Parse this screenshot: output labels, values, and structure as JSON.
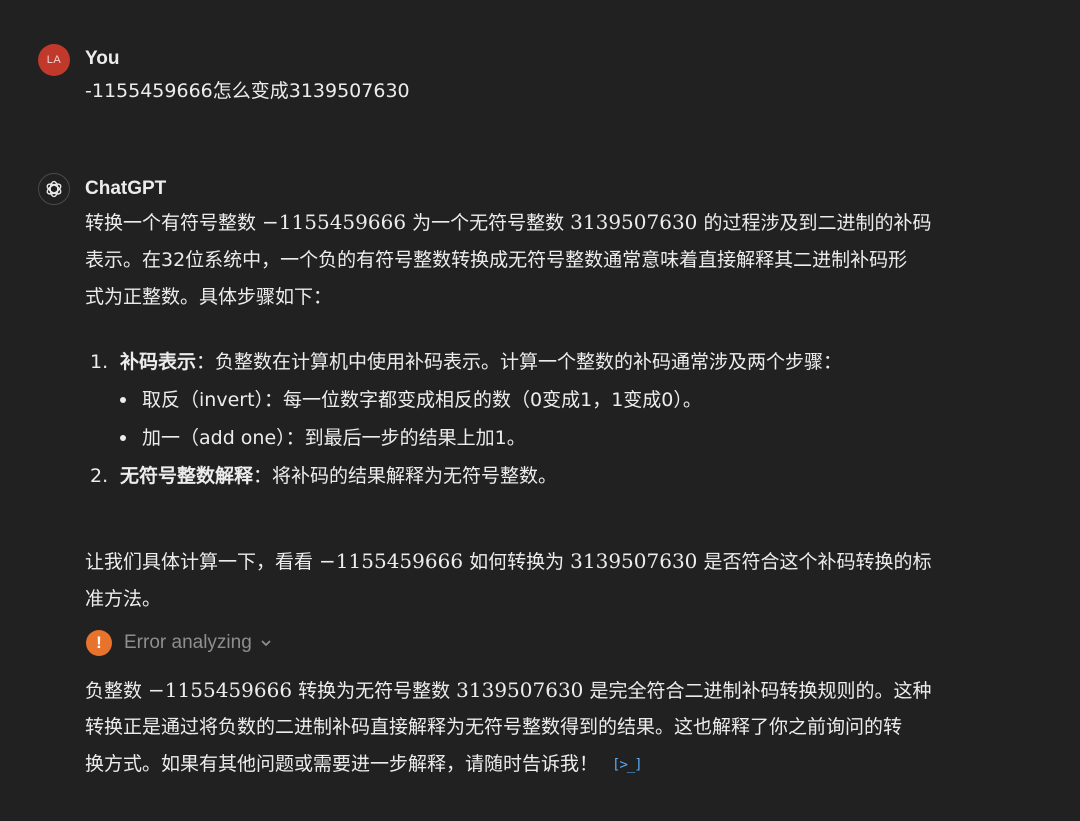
{
  "user": {
    "avatar_initials": "LA",
    "author": "You",
    "message": "-1155459666怎么变成3139507630"
  },
  "assistant": {
    "author": "ChatGPT",
    "avatar_icon": "openai-logo-icon",
    "para1": {
      "l1_a": "转换一个有符号整数 ",
      "l1_num1": "−1155459666",
      "l1_b": " 为一个无符号整数 ",
      "l1_num2": "3139507630",
      "l1_c": " 的过程涉及到二进制的补码",
      "l2": "表示。在32位系统中，一个负的有符号整数转换成无符号整数通常意味着直接解释其二进制补码形",
      "l3": "式为正整数。具体步骤如下："
    },
    "list": {
      "item1_num": "1.",
      "item1_bold": "补码表示",
      "item1_text": "：负整数在计算机中使用补码表示。计算一个整数的补码通常涉及两个步骤：",
      "sub1": "取反（invert）：每一位数字都变成相反的数（0变成1，1变成0）。",
      "sub2": "加一（add one）：到最后一步的结果上加1。",
      "item2_num": "2.",
      "item2_bold": "无符号整数解释",
      "item2_text": "：将补码的结果解释为无符号整数。"
    },
    "para2": {
      "l1_a": "让我们具体计算一下，看看 ",
      "l1_num1": "−1155459666",
      "l1_b": " 如何转换为 ",
      "l1_num2": "3139507630",
      "l1_c": " 是否符合这个补码转换的标",
      "l2": "准方法。"
    },
    "error": {
      "icon_label": "!",
      "label": "Error analyzing",
      "icon": "chevron-down-icon",
      "accent": "#e8732c"
    },
    "para3": {
      "l1_a": "负整数 ",
      "l1_num1": "−1155459666",
      "l1_b": " 转换为无符号整数 ",
      "l1_num2": "3139507630",
      "l1_c": " 是完全符合二进制补码转换规则的。这种",
      "l2": "转换正是通过将负数的二进制补码直接解释为无符号整数得到的结果。这也解释了你之前询问的转",
      "l3": "换方式。如果有其他问题或需要进一步解释，请随时告诉我！",
      "code_link": "[>_]"
    }
  }
}
